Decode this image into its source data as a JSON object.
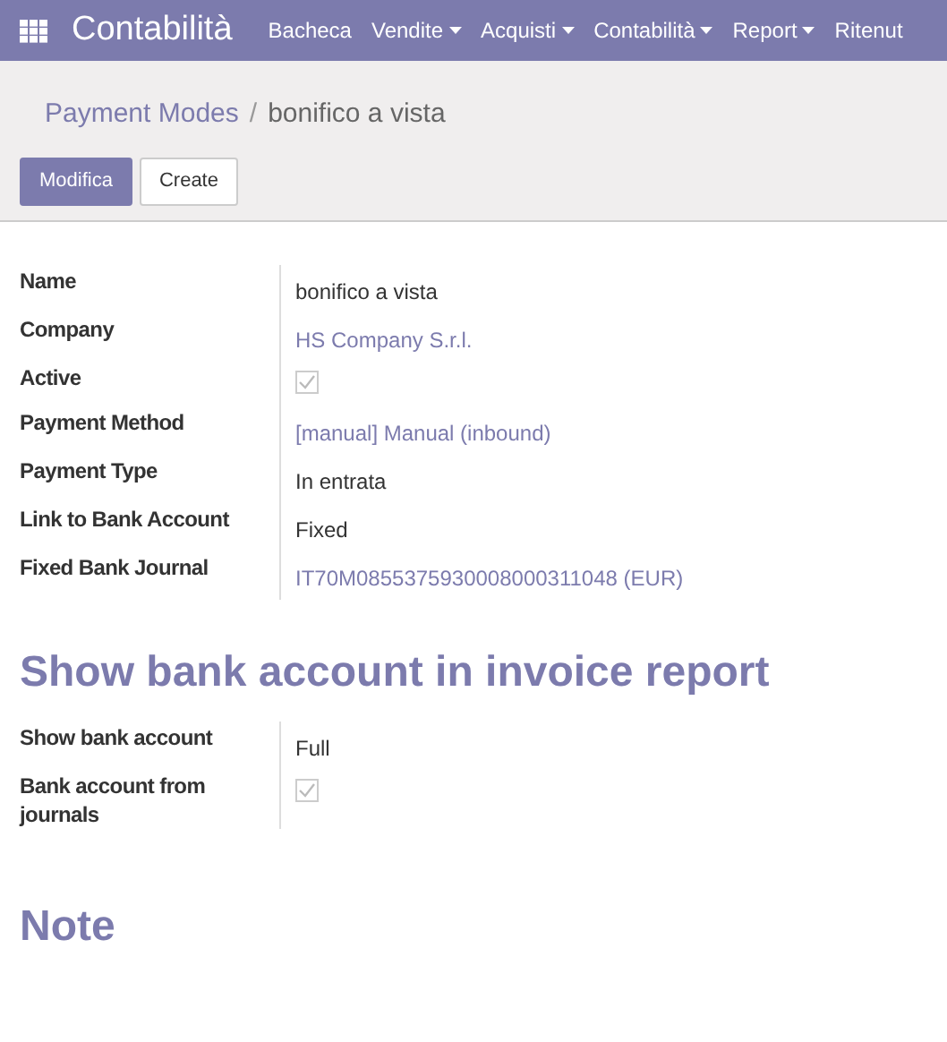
{
  "app": {
    "title": "Contabilità"
  },
  "nav": [
    {
      "label": "Bacheca",
      "dropdown": false
    },
    {
      "label": "Vendite",
      "dropdown": true
    },
    {
      "label": "Acquisti",
      "dropdown": true
    },
    {
      "label": "Contabilità",
      "dropdown": true
    },
    {
      "label": "Report",
      "dropdown": true
    },
    {
      "label": "Ritenut",
      "dropdown": false
    }
  ],
  "breadcrumb": {
    "parent": "Payment Modes",
    "separator": "/",
    "current": "bonifico a vista"
  },
  "buttons": [
    {
      "label": "Modifica",
      "primary": true
    },
    {
      "label": "Create",
      "primary": false
    }
  ],
  "fields": [
    {
      "label": "Name",
      "kind": "text",
      "value": "bonifico a vista"
    },
    {
      "label": "Company",
      "kind": "link",
      "value": "HS Company S.r.l."
    },
    {
      "label": "Active",
      "kind": "checkbox",
      "checked": true
    },
    {
      "label": "Payment Method",
      "kind": "link",
      "value": "[manual] Manual (inbound)"
    },
    {
      "label": "Payment Type",
      "kind": "text",
      "value": "In entrata"
    },
    {
      "label": "Link to Bank Account",
      "kind": "text",
      "value": "Fixed"
    },
    {
      "label": "Fixed Bank Journal",
      "kind": "link",
      "value": "IT70M0855375930008000311048 (EUR)"
    }
  ],
  "section": {
    "title": "Show bank account in invoice report",
    "fields": [
      {
        "label": "Show bank account",
        "kind": "text",
        "value": "Full"
      },
      {
        "label": "Bank account from journals",
        "kind": "checkbox",
        "checked": true
      }
    ]
  },
  "note": {
    "title": "Note"
  }
}
